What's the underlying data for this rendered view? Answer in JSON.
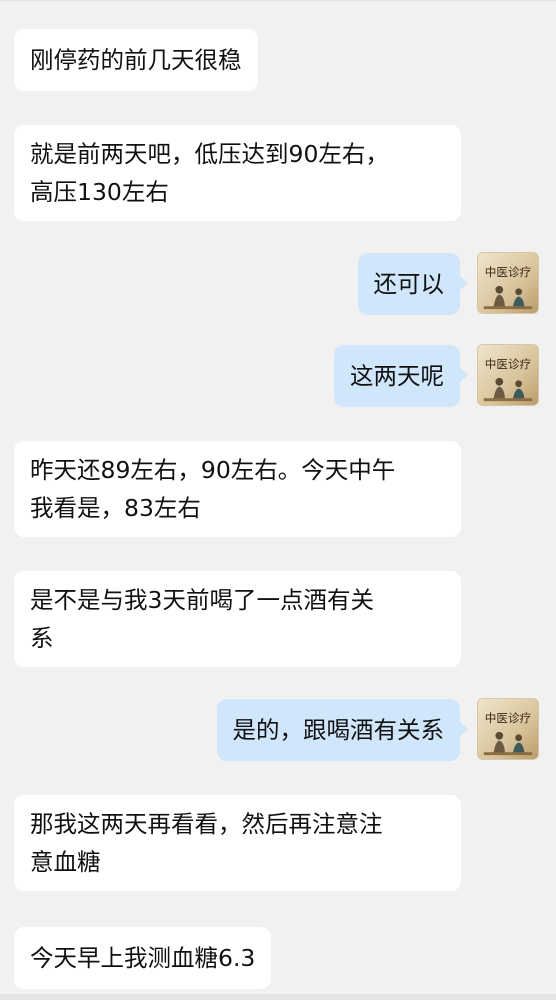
{
  "avatar": {
    "label": "中医诊疗",
    "icon": "doctor-avatar-icon"
  },
  "colors": {
    "background": "#f1f1f1",
    "incoming_bubble": "#ffffff",
    "outgoing_bubble": "#cfe6fb"
  },
  "messages": [
    {
      "side": "in",
      "text": "刚停药的前几天很稳"
    },
    {
      "side": "in",
      "text": "就是前两天吧，低压达到90左右，\n高压130左右"
    },
    {
      "side": "out",
      "text": "还可以"
    },
    {
      "side": "out",
      "text": "这两天呢"
    },
    {
      "side": "in",
      "text": "昨天还89左右，90左右。今天中午\n我看是，83左右"
    },
    {
      "side": "in",
      "text": "是不是与我3天前喝了一点酒有关\n系"
    },
    {
      "side": "out",
      "text": "是的，跟喝酒有关系"
    },
    {
      "side": "in",
      "text": "那我这两天再看看，然后再注意注\n意血糖"
    },
    {
      "side": "in",
      "text": "今天早上我测血糖6.3"
    }
  ]
}
